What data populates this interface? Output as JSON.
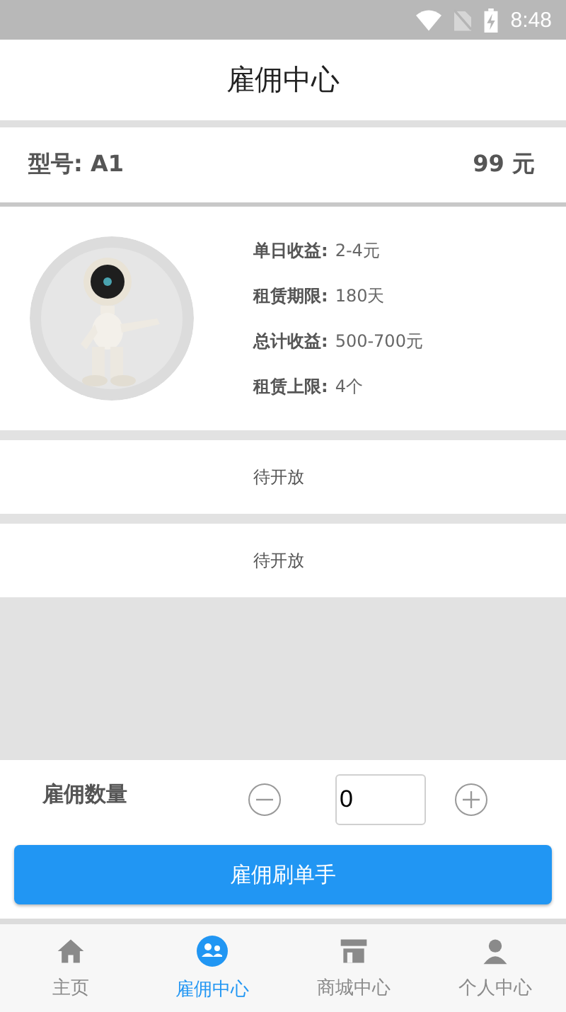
{
  "status_bar": {
    "time": "8:48"
  },
  "header": {
    "title": "雇佣中心"
  },
  "model": {
    "name": "型号: A1",
    "price": "99 元"
  },
  "product": {
    "details": [
      {
        "label": "单日收益:",
        "value": "2-4元"
      },
      {
        "label": "租赁期限:",
        "value": "180天"
      },
      {
        "label": "总计收益:",
        "value": "500-700元"
      },
      {
        "label": "租赁上限:",
        "value": "4个"
      }
    ]
  },
  "placeholders": [
    "待开放",
    "待开放"
  ],
  "quantity": {
    "label": "雇佣数量",
    "value": "0"
  },
  "hire_button": "雇佣刷单手",
  "tabs": [
    {
      "label": "主页",
      "selected": false
    },
    {
      "label": "雇佣中心",
      "selected": true
    },
    {
      "label": "商城中心",
      "selected": false
    },
    {
      "label": "个人中心",
      "selected": false
    }
  ]
}
